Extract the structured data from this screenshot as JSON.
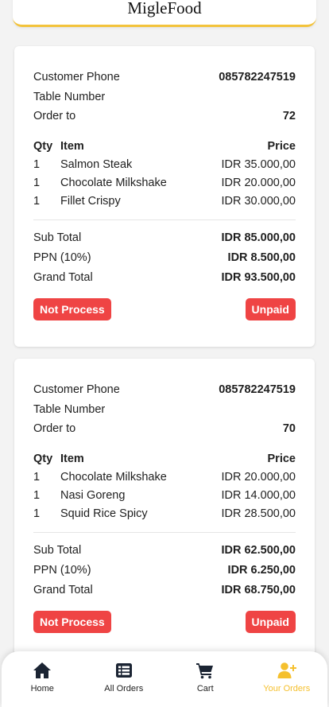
{
  "app": {
    "brand": "MigleFood"
  },
  "labels": {
    "customer_phone": "Customer Phone",
    "table_number": "Table Number",
    "order_to": "Order to",
    "qty": "Qty",
    "item": "Item",
    "price": "Price",
    "sub_total": "Sub Total",
    "ppn": "PPN (10%)",
    "grand_total": "Grand Total"
  },
  "orders": [
    {
      "customer_phone": "085782247519",
      "table_number": "",
      "order_to": "72",
      "items": [
        {
          "qty": "1",
          "name": "Salmon Steak",
          "price": "IDR 35.000,00"
        },
        {
          "qty": "1",
          "name": "Chocolate Milkshake",
          "price": "IDR 20.000,00"
        },
        {
          "qty": "1",
          "name": "Fillet Crispy",
          "price": "IDR 30.000,00"
        }
      ],
      "sub_total": "IDR 85.000,00",
      "ppn": "IDR 8.500,00",
      "grand_total": "IDR 93.500,00",
      "process_status": "Not Process",
      "payment_status": "Unpaid"
    },
    {
      "customer_phone": "085782247519",
      "table_number": "",
      "order_to": "70",
      "items": [
        {
          "qty": "1",
          "name": "Chocolate Milkshake",
          "price": "IDR 20.000,00"
        },
        {
          "qty": "1",
          "name": "Nasi Goreng",
          "price": "IDR 14.000,00"
        },
        {
          "qty": "1",
          "name": "Squid Rice Spicy",
          "price": "IDR 28.500,00"
        }
      ],
      "sub_total": "IDR 62.500,00",
      "ppn": "IDR 6.250,00",
      "grand_total": "IDR 68.750,00",
      "process_status": "Not Process",
      "payment_status": "Unpaid"
    }
  ],
  "nav": [
    {
      "label": "Home",
      "icon": "home-icon"
    },
    {
      "label": "All Orders",
      "icon": "list-icon"
    },
    {
      "label": "Cart",
      "icon": "cart-icon"
    },
    {
      "label": "Your Orders",
      "icon": "user-plus-icon",
      "active": true
    }
  ],
  "colors": {
    "accent": "#f5c02e",
    "badge": "#ef4444"
  }
}
